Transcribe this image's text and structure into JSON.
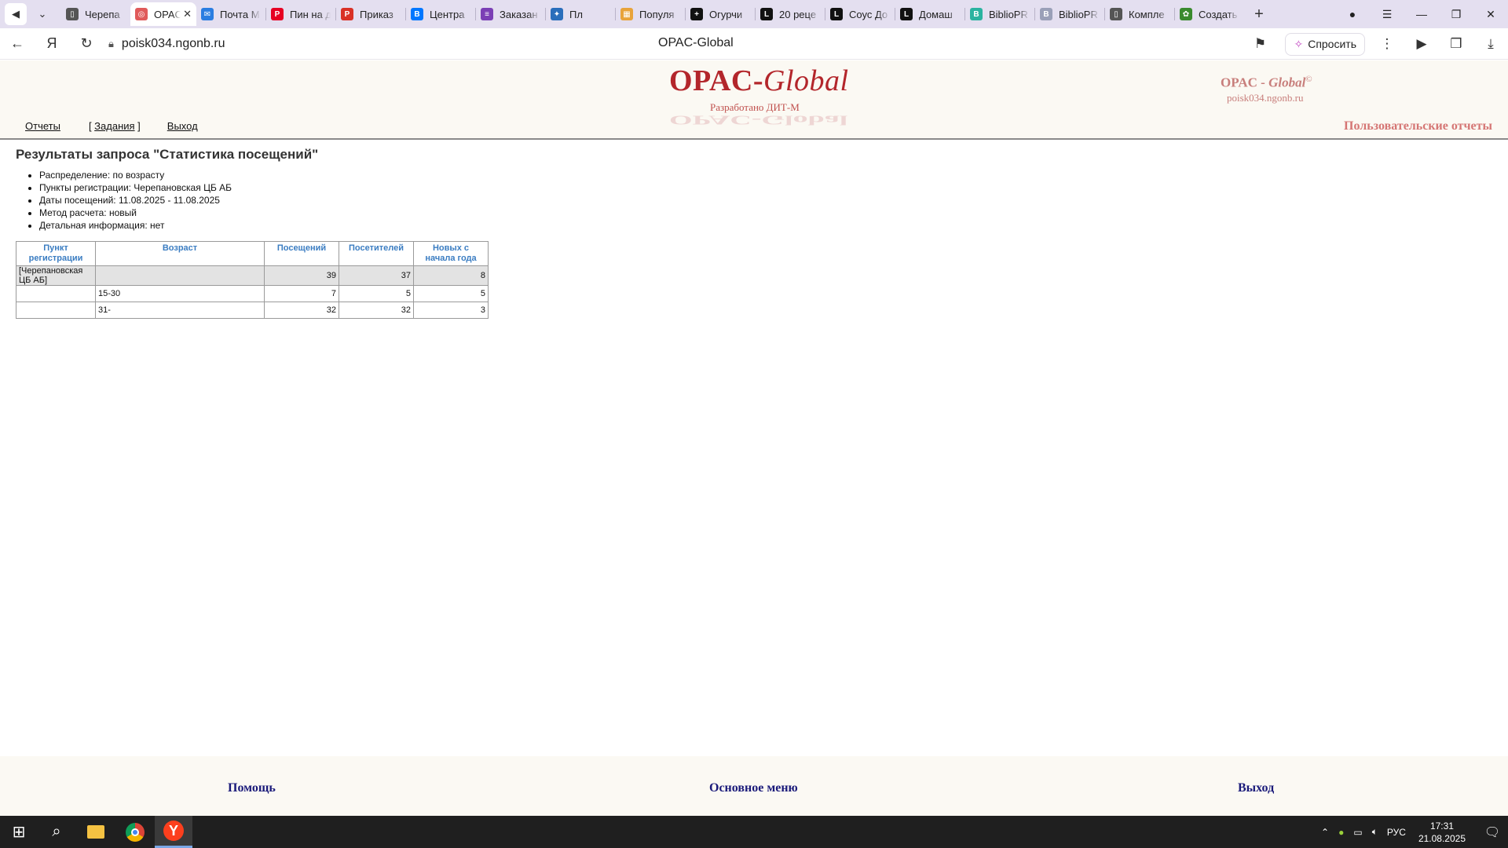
{
  "browser": {
    "tabs": [
      {
        "label": "Черепа",
        "icon": "page-icon",
        "color": "#555555"
      },
      {
        "label": "OPAC",
        "icon": "opac-icon",
        "color": "#e05a5a",
        "active": true
      },
      {
        "label": "Почта М",
        "icon": "mail-icon",
        "color": "#2a7de1"
      },
      {
        "label": "Пин на д",
        "icon": "pinterest-icon",
        "color": "#e60023"
      },
      {
        "label": "Приказ",
        "icon": "pdf-icon",
        "color": "#d93025"
      },
      {
        "label": "Центра",
        "icon": "vk-icon",
        "color": "#0077ff"
      },
      {
        "label": "Заказан",
        "icon": "orders-icon",
        "color": "#7b3fb5"
      },
      {
        "label": "Пл",
        "icon": "star-icon",
        "color": "#2a6ebb"
      },
      {
        "label": "Популя",
        "icon": "image-icon",
        "color": "#e8a33a"
      },
      {
        "label": "Огурчи",
        "icon": "plus-circle-icon",
        "color": "#111111"
      },
      {
        "label": "20 реце",
        "icon": "l-icon",
        "color": "#111111"
      },
      {
        "label": "Соус До",
        "icon": "l-icon",
        "color": "#111111"
      },
      {
        "label": "Домаш",
        "icon": "l-icon",
        "color": "#111111"
      },
      {
        "label": "BiblioPR",
        "icon": "biblio-icon",
        "color": "#2bb3a0"
      },
      {
        "label": "BiblioPR",
        "icon": "biblio-icon",
        "color": "#9aa0b8"
      },
      {
        "label": "Компле",
        "icon": "page-icon",
        "color": "#555555"
      },
      {
        "label": "Создать",
        "icon": "gear-icon",
        "color": "#3a8a2e"
      }
    ],
    "url": "poisk034.ngonb.ru",
    "page_title": "OPAC-Global",
    "ask_label": "Спросить"
  },
  "header": {
    "logo_main": "OPAC-",
    "logo_italic": "Global",
    "developed_by": "Разработано ДИТ-М",
    "brand_right_main": "OPAC - ",
    "brand_right_italic": "Global",
    "brand_right_mark": "©",
    "brand_host": "poisk034.ngonb.ru",
    "menu": {
      "reports": "Отчеты",
      "tasks_open": "[ ",
      "tasks": "Задания",
      "tasks_close": " ]",
      "exit": "Выход"
    },
    "user_reports": "Пользовательские отчеты"
  },
  "report": {
    "title": "Результаты запроса \"Статистика посещений\"",
    "params": [
      "Распределение: по возрасту",
      "Пункты регистрации: Черепановская ЦБ АБ",
      "Даты посещений: 11.08.2025 - 11.08.2025",
      "Метод расчета: новый",
      "Детальная информация: нет"
    ],
    "table": {
      "headers": [
        "Пункт регистрации",
        "Возраст",
        "Посещений",
        "Посетителей",
        "Новых с начала года"
      ],
      "rows": [
        {
          "point": "[Черепановская ЦБ АБ]",
          "age": "",
          "visits": "39",
          "visitors": "37",
          "new": "8",
          "group": true
        },
        {
          "point": "",
          "age": "15-30",
          "visits": "7",
          "visitors": "5",
          "new": "5"
        },
        {
          "point": "",
          "age": "31-",
          "visits": "32",
          "visitors": "32",
          "new": "3"
        }
      ]
    }
  },
  "footer": {
    "help": "Помощь",
    "main_menu": "Основное меню",
    "exit": "Выход"
  },
  "taskbar": {
    "lang": "РУС",
    "time": "17:31",
    "date": "21.08.2025"
  }
}
